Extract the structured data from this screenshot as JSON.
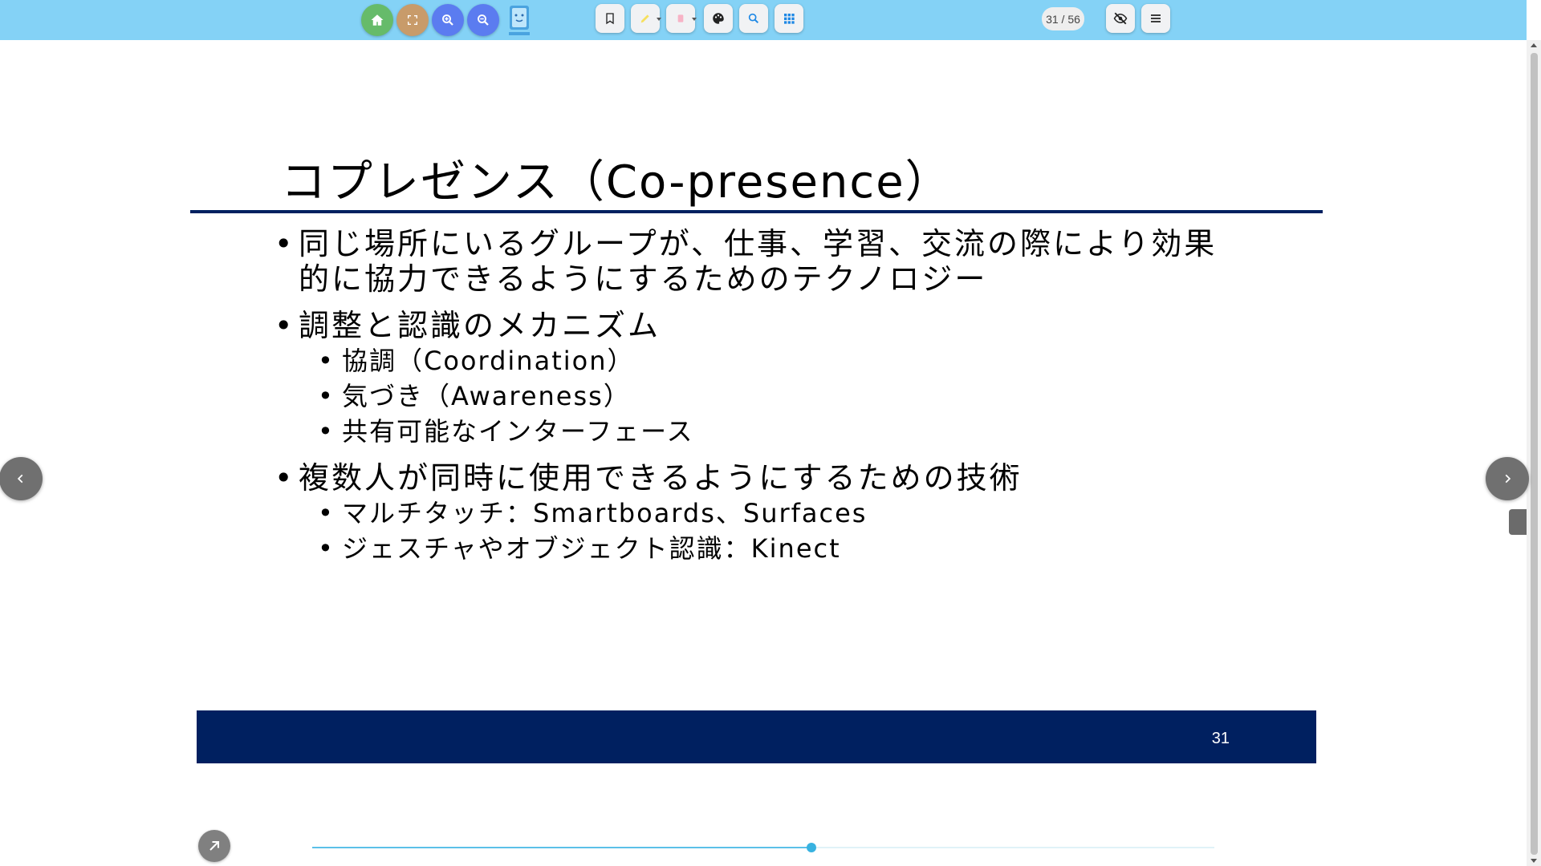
{
  "toolbar": {
    "page_counter": "31 / 56",
    "colors": {
      "bar": "#84d2f6",
      "home": "#66bb6a",
      "fullscreen": "#c89b6a",
      "zoom": "#5b7cf0"
    },
    "icons": [
      "home-icon",
      "fullscreen-icon",
      "zoom-in-icon",
      "zoom-out-icon",
      "bookmark-icon",
      "highlighter-icon",
      "eraser-icon",
      "palette-icon",
      "search-icon",
      "grid-icon",
      "hide-icon",
      "menu-icon"
    ]
  },
  "slide": {
    "title": "コプレゼンス（Co-presence）",
    "bullets": [
      {
        "text": "同じ場所にいるグループが、仕事、学習、交流の際により効果的に協力できるようにするためのテクノロジー"
      },
      {
        "text": "調整と認識のメカニズム",
        "sub": [
          "協調（Coordination）",
          "気づき（Awareness）",
          "共有可能なインターフェース"
        ]
      },
      {
        "text": "複数人が同時に使用できるようにするための技術",
        "sub": [
          "マルチタッチ：Smartboards、Surfaces",
          "ジェスチャやオブジェクト認識：Kinect"
        ]
      }
    ],
    "number": "31",
    "colors": {
      "accent": "#002060"
    }
  },
  "progress": {
    "current": 31,
    "total": 56
  }
}
